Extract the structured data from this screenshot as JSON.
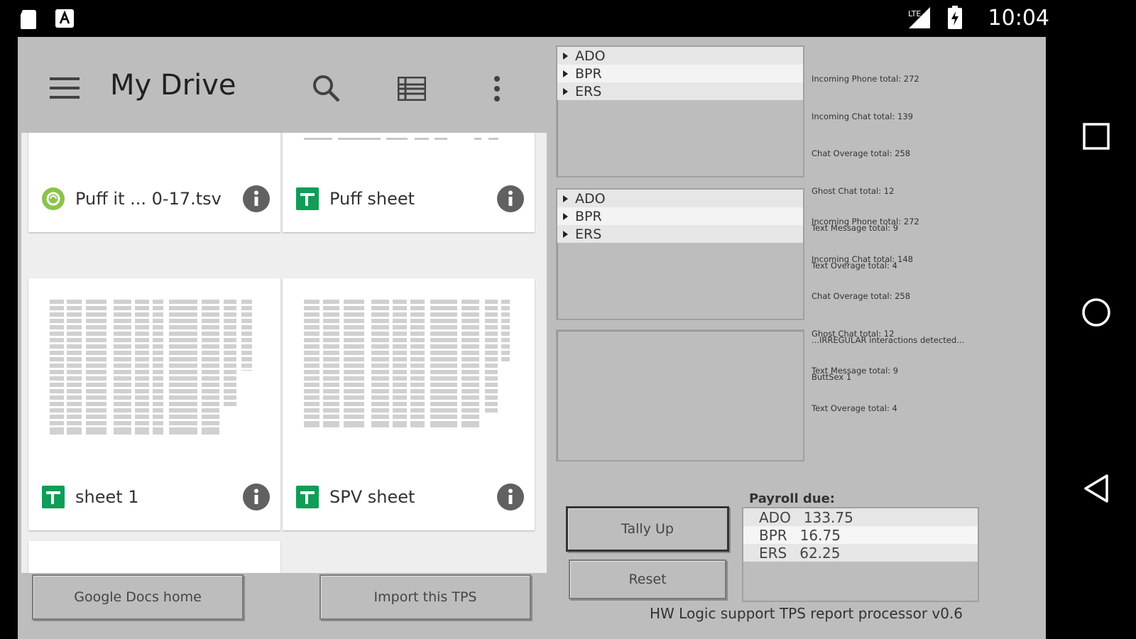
{
  "status_bar": {
    "time": "10:04",
    "network": "LTE"
  },
  "drive": {
    "title": "My Drive",
    "files": [
      {
        "name": "Puff it ... 0-17.tsv",
        "type": "tsv",
        "color": "#8bc34a"
      },
      {
        "name": "Puff sheet",
        "type": "sheet",
        "color": "#0f9d58"
      },
      {
        "name": "sheet 1",
        "type": "sheet",
        "color": "#0f9d58"
      },
      {
        "name": "SPV sheet",
        "type": "sheet",
        "color": "#0f9d58"
      }
    ]
  },
  "buttons": {
    "google_docs_home": "Google Docs home",
    "import_tps": "Import this TPS",
    "tally_up": "Tally Up",
    "reset": "Reset"
  },
  "panels": [
    {
      "tree": [
        "ADO",
        "BPR",
        "ERS"
      ],
      "stats": [
        "Incoming Phone total: 272",
        "Incoming Chat total: 139",
        "Chat Overage total: 258",
        "Ghost Chat total: 12",
        "Text Message total: 9",
        "Text Overage total: 4",
        "",
        "...IRREGULAR interactions detected...",
        "ButtSex 1"
      ]
    },
    {
      "tree": [
        "ADO",
        "BPR",
        "ERS"
      ],
      "stats": [
        "Incoming Phone total: 272",
        "Incoming Chat total: 148",
        "Chat Overage total: 258",
        "Ghost Chat total: 12",
        "Text Message total: 9",
        "Text Overage total: 4"
      ]
    }
  ],
  "payroll": {
    "label": "Payroll due:",
    "rows": [
      {
        "name": "ADO",
        "value": "133.75"
      },
      {
        "name": "BPR",
        "value": "16.75"
      },
      {
        "name": "ERS",
        "value": "62.25"
      }
    ]
  },
  "footer": {
    "version": "HW Logic support TPS report processor v0.6"
  },
  "colors": {
    "app_bg": "#bdbdbd",
    "sheet_green": "#0f9d58",
    "tsv_green": "#8bc34a",
    "info_gray": "#616161"
  }
}
